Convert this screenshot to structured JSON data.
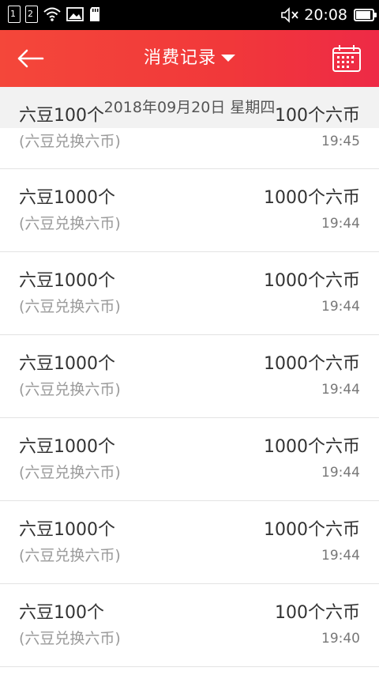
{
  "status_bar": {
    "sim1": "1",
    "sim2": "2",
    "time": "20:08",
    "battery_level": 0.9
  },
  "header": {
    "title": "消费记录",
    "back_icon": "arrow-left-icon",
    "calendar_icon": "calendar-icon"
  },
  "date_header": "2018年09月20日 星期四",
  "records": [
    {
      "title": "六豆100个",
      "sub": "(六豆兑换六币)",
      "amount": "100个六币",
      "time": "19:45"
    },
    {
      "title": "六豆1000个",
      "sub": "(六豆兑换六币)",
      "amount": "1000个六币",
      "time": "19:44"
    },
    {
      "title": "六豆1000个",
      "sub": "(六豆兑换六币)",
      "amount": "1000个六币",
      "time": "19:44"
    },
    {
      "title": "六豆1000个",
      "sub": "(六豆兑换六币)",
      "amount": "1000个六币",
      "time": "19:44"
    },
    {
      "title": "六豆1000个",
      "sub": "(六豆兑换六币)",
      "amount": "1000个六币",
      "time": "19:44"
    },
    {
      "title": "六豆1000个",
      "sub": "(六豆兑换六币)",
      "amount": "1000个六币",
      "time": "19:44"
    },
    {
      "title": "六豆100个",
      "sub": "(六豆兑换六币)",
      "amount": "100个六币",
      "time": "19:40"
    }
  ]
}
